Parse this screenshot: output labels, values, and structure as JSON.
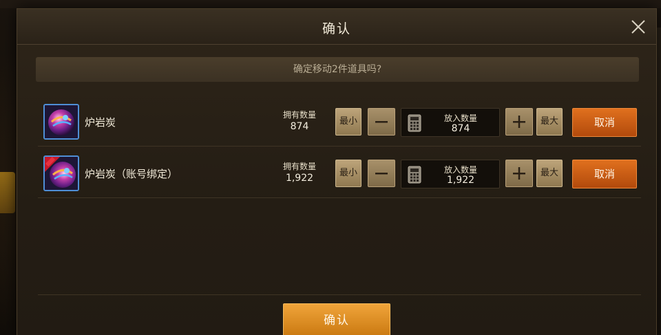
{
  "dialog": {
    "title": "确认",
    "prompt": "确定移动2件道具吗?"
  },
  "items": [
    {
      "name": "炉岩炭",
      "owned_label": "拥有数量",
      "owned_value": "874",
      "min_label": "最小",
      "max_label": "最大",
      "put_label": "放入数量",
      "put_value": "874",
      "cancel_label": "取消",
      "icon": "lava-coal-orb-icon"
    },
    {
      "name": "炉岩炭（账号绑定）",
      "owned_label": "拥有数量",
      "owned_value": "1,922",
      "min_label": "最小",
      "max_label": "最大",
      "put_label": "放入数量",
      "put_value": "1,922",
      "cancel_label": "取消",
      "icon": "lava-coal-orb-bound-icon"
    }
  ],
  "footer": {
    "confirm_label": "确认"
  },
  "colors": {
    "cancel": "#d0621a",
    "confirm": "#e69628",
    "icon_border": "#4f8fd6"
  }
}
